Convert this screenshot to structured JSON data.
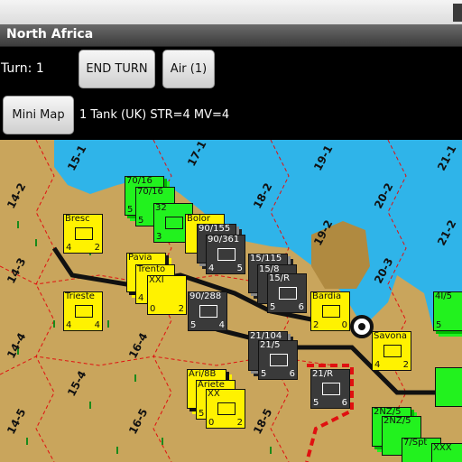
{
  "app": {
    "title": "North Africa"
  },
  "toolbar": {
    "turn_label": "Turn: 1",
    "end_turn_label": "END TURN",
    "air_label": "Air (1)",
    "minimap_label": "Mini Map",
    "selected_unit_info": "1 Tank (UK) STR=4 MV=4"
  },
  "map": {
    "hex_labels": [
      {
        "text": "15-1"
      },
      {
        "text": "17-1"
      },
      {
        "text": "19-1"
      },
      {
        "text": "21-1"
      },
      {
        "text": "14-2"
      },
      {
        "text": "18-2"
      },
      {
        "text": "20-2"
      },
      {
        "text": "19-2"
      },
      {
        "text": "21-2"
      },
      {
        "text": "14-3"
      },
      {
        "text": "20-3"
      },
      {
        "text": "14-4"
      },
      {
        "text": "16-4"
      },
      {
        "text": "15-4"
      },
      {
        "text": "14-5"
      },
      {
        "text": "16-5"
      },
      {
        "text": "18-5"
      }
    ],
    "counters": [
      {
        "side": "uk",
        "name": "70/16",
        "str": "5",
        "mv": "4"
      },
      {
        "side": "uk",
        "name": "70/16",
        "str": "5",
        "mv": ""
      },
      {
        "side": "uk",
        "name": "32",
        "str": "3",
        "mv": "4"
      },
      {
        "side": "it",
        "name": "Bresc",
        "str": "4",
        "mv": "2"
      },
      {
        "side": "it",
        "name": "Bolor",
        "str": "",
        "mv": ""
      },
      {
        "side": "de",
        "name": "90/155",
        "str": "",
        "mv": ""
      },
      {
        "side": "de",
        "name": "90/361",
        "str": "4",
        "mv": "5"
      },
      {
        "side": "it",
        "name": "Pavia",
        "str": "",
        "mv": ""
      },
      {
        "side": "it",
        "name": "Trento",
        "str": "4",
        "mv": "2"
      },
      {
        "side": "it",
        "name": "XXI",
        "str": "0",
        "mv": "2"
      },
      {
        "side": "it",
        "name": "Trieste",
        "str": "4",
        "mv": "4"
      },
      {
        "side": "de",
        "name": "15/115",
        "str": "",
        "mv": ""
      },
      {
        "side": "de",
        "name": "15/8",
        "str": "",
        "mv": ""
      },
      {
        "side": "de",
        "name": "15/R",
        "str": "5",
        "mv": "6"
      },
      {
        "side": "it",
        "name": "Bardia",
        "str": "2",
        "mv": "0"
      },
      {
        "side": "de",
        "name": "90/288",
        "str": "5",
        "mv": "4"
      },
      {
        "side": "de",
        "name": "21/104",
        "str": "",
        "mv": ""
      },
      {
        "side": "de",
        "name": "21/5",
        "str": "5",
        "mv": "6"
      },
      {
        "side": "it",
        "name": "Savona",
        "str": "4",
        "mv": "2"
      },
      {
        "side": "uk",
        "name": "4I/5",
        "str": "5",
        "mv": ""
      },
      {
        "side": "uk",
        "name": "",
        "str": "",
        "mv": ""
      },
      {
        "side": "de",
        "name": "21/R",
        "str": "5",
        "mv": "6"
      },
      {
        "side": "it",
        "name": "Ari/8B",
        "str": "",
        "mv": ""
      },
      {
        "side": "it",
        "name": "Ariete",
        "str": "5",
        "mv": ""
      },
      {
        "side": "it",
        "name": "XX",
        "str": "0",
        "mv": "2"
      },
      {
        "side": "uk",
        "name": "2NZ/5",
        "str": "",
        "mv": ""
      },
      {
        "side": "uk",
        "name": "2NZ/5",
        "str": "",
        "mv": ""
      },
      {
        "side": "uk",
        "name": "7/Spt",
        "str": "",
        "mv": ""
      },
      {
        "side": "uk",
        "name": "XXX",
        "str": "",
        "mv": ""
      }
    ]
  },
  "colors": {
    "desert": "#c9a55c",
    "sea": "#2fb4e9",
    "italian": "#fff200",
    "german": "#3a3a3a",
    "british": "#22f21e",
    "border_red": "#e01010"
  }
}
